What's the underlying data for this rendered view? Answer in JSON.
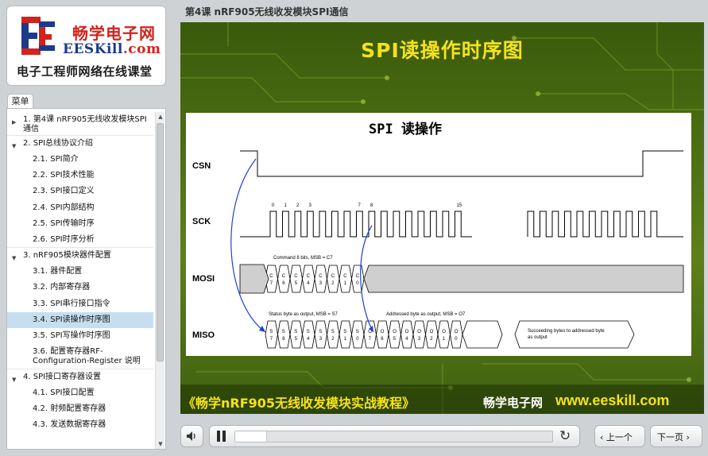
{
  "brand": {
    "name_cn": "畅学电子网",
    "name_en_main": "EESKill",
    "name_en_suffix": ".com",
    "slogan": "电子工程师网络在线课堂",
    "logo_mark": "EE"
  },
  "lesson_title": "第4课 nRF905无线收发模块SPI通信",
  "menu": {
    "tab_label": "菜单",
    "items": [
      {
        "label": "1. 第4课 nRF905无线收发模块SPI通信",
        "type": "section",
        "expanded": false
      },
      {
        "label": "2. SPI总线协议介绍",
        "type": "section",
        "expanded": true
      },
      {
        "label": "2.1. SPI简介",
        "type": "sub"
      },
      {
        "label": "2.2. SPI技术性能",
        "type": "sub"
      },
      {
        "label": "2.3. SPI接口定义",
        "type": "sub"
      },
      {
        "label": "2.4. SPI内部结构",
        "type": "sub"
      },
      {
        "label": "2.5. SPI传输时序",
        "type": "sub"
      },
      {
        "label": "2.6. SPI时序分析",
        "type": "sub"
      },
      {
        "label": "3. nRF905模块器件配置",
        "type": "section",
        "expanded": true
      },
      {
        "label": "3.1. 器件配置",
        "type": "sub"
      },
      {
        "label": "3.2. 内部寄存器",
        "type": "sub"
      },
      {
        "label": "3.3. SPI串行接口指令",
        "type": "sub"
      },
      {
        "label": "3.4. SPI读操作时序图",
        "type": "sub",
        "active": true
      },
      {
        "label": "3.5. SPI写操作时序图",
        "type": "sub"
      },
      {
        "label": "3.6. 配置寄存器RF-Configuration-Register 说明",
        "type": "sub"
      },
      {
        "label": "4. SPI接口寄存器设置",
        "type": "section",
        "expanded": true
      },
      {
        "label": "4.1. SPI接口配置",
        "type": "sub"
      },
      {
        "label": "4.2. 射频配置寄存器",
        "type": "sub"
      },
      {
        "label": "4.3. 发送数据寄存器",
        "type": "sub"
      }
    ]
  },
  "slide": {
    "title": "SPI读操作时序图",
    "diagram": {
      "heading": "SPI 读操作",
      "signals": [
        "CSN",
        "SCK",
        "MOSI",
        "MISO"
      ],
      "sck_tick_labels": [
        "0",
        "1",
        "2",
        "3",
        "7",
        "8",
        "15"
      ],
      "mosi_caption": "Command 8 bits, MSB = C7",
      "mosi_bits": [
        "C7",
        "C6",
        "C5",
        "C4",
        "C3",
        "C2",
        "C1",
        "C0"
      ],
      "miso_status_caption": "Status byte as output, MSB = S7",
      "miso_address_caption": "Addressed byte as output, MSB = O7",
      "miso_status_bits": [
        "S7",
        "S6",
        "S5",
        "S4",
        "S3",
        "S2",
        "S1",
        "S0"
      ],
      "miso_data_bits": [
        "O7",
        "O6",
        "O5",
        "O4",
        "O3",
        "O2",
        "O1",
        "O0"
      ],
      "miso_tail_line1": "Succeeding bytes to addressed byte",
      "miso_tail_line2": "as output"
    },
    "footer_course": "《畅学nRF905无线收发模块实战教程》",
    "footer_brand": "畅学电子网",
    "footer_url": "www.eeskill.com"
  },
  "player": {
    "progress": 0.1,
    "prev_label": "‹ 上一个",
    "next_label": "下一页 ›",
    "icons": [
      "volume-icon",
      "pause-icon",
      "replay-icon"
    ]
  },
  "colors": {
    "accent_yellow": "#f5e21a",
    "brand_red": "#d2221c",
    "brand_blue": "#1b3a8a",
    "menu_active": "#c5dff0"
  }
}
